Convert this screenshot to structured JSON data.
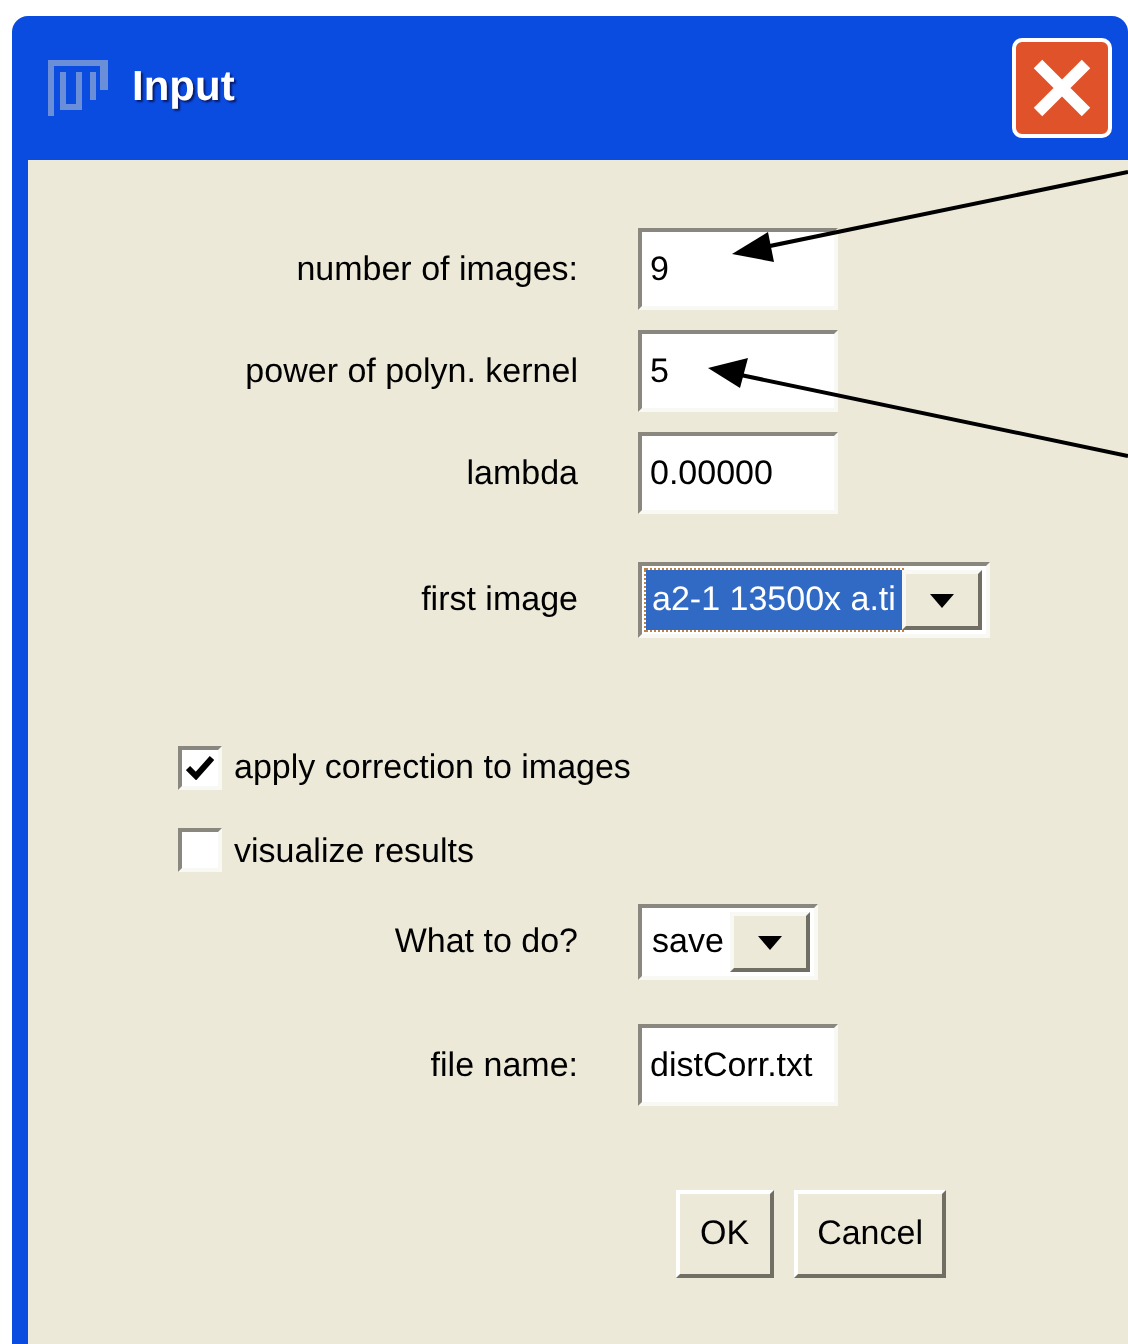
{
  "window": {
    "title": "Input"
  },
  "rows": [
    {
      "kind": "text",
      "label": "number of images:",
      "value": "9"
    },
    {
      "kind": "text",
      "label": "power of polyn. kernel",
      "value": "5"
    },
    {
      "kind": "text",
      "label": "lambda",
      "value": "0.00000"
    },
    {
      "kind": "choice",
      "label": "first image",
      "value": "a2-1 13500x a.ti",
      "highlighted": true
    },
    {
      "kind": "check",
      "label": "apply correction to images",
      "checked": true
    },
    {
      "kind": "check",
      "label": "visualize results",
      "checked": false
    },
    {
      "kind": "choice",
      "label": "What to do?",
      "value": "save",
      "highlighted": false
    },
    {
      "kind": "text",
      "label": "file name:",
      "value": "distCorr.txt"
    }
  ],
  "buttons": [
    "OK",
    "Cancel"
  ]
}
